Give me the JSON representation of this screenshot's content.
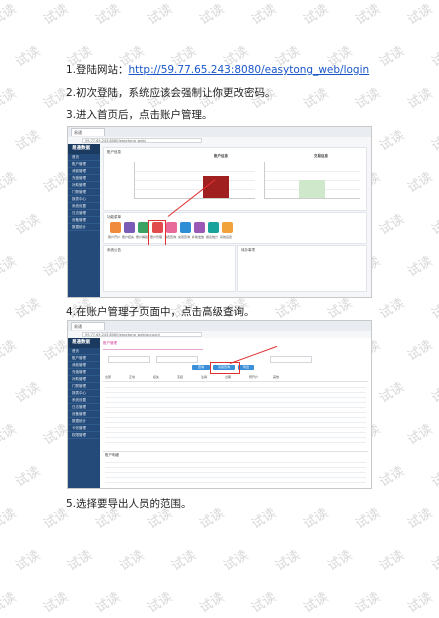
{
  "watermark": "试读",
  "steps": [
    {
      "prefix": "1.登陆网站：",
      "link": "http://59.77.65.243:8080/easytong_web/login"
    },
    {
      "text": "2.初次登陆，系统应该会强制让你更改密码。"
    },
    {
      "text": "3.进入首页后，点击账户管理。"
    },
    {
      "text": "4.在账户管理子页面中，点击高级查询。"
    },
    {
      "text": "5.选择要导出人员的范围。"
    }
  ],
  "screenshot1": {
    "tab_title": "易通",
    "url": "59.77.65.243:8080/easytong_web/",
    "logo": "易通数据",
    "sidebar_items": [
      "首页",
      "账户管理",
      "消费管理",
      "充值管理",
      "补助管理",
      "门禁管理",
      "报表中心",
      "系统设置",
      "日志管理",
      "设备管理",
      "数据统计"
    ],
    "chart_left_title": "账户信息",
    "chart_right_title": "交易信息",
    "apps_title": "功能菜单",
    "apps": [
      {
        "label": "账户开户",
        "color": "#f08a3c"
      },
      {
        "label": "账户挂失",
        "color": "#7a5bb5"
      },
      {
        "label": "账户解挂",
        "color": "#3aa363"
      },
      {
        "label": "账户管理",
        "color": "#e24b4b"
      },
      {
        "label": "消费查询",
        "color": "#e86a9a"
      },
      {
        "label": "充值查询",
        "color": "#2e8fd6"
      },
      {
        "label": "补助发放",
        "color": "#9b59b6"
      },
      {
        "label": "报表统计",
        "color": "#18a39b"
      },
      {
        "label": "系统设置",
        "color": "#f2a23a"
      }
    ],
    "panel_left_title": "系统公告",
    "panel_right_title": "待办事项"
  },
  "screenshot2": {
    "tab_title": "易通",
    "url": "59.77.65.243:8080/easytong_web/account",
    "logo": "易通数据",
    "sidebar_items": [
      "首页",
      "账户管理",
      "消费管理",
      "充值管理",
      "补助管理",
      "门禁管理",
      "报表中心",
      "系统设置",
      "日志管理",
      "设备管理",
      "数据统计",
      "卡务管理",
      "权限管理"
    ],
    "header_note": "账户管理",
    "buttons": [
      "查询",
      "高级查询",
      "导出"
    ],
    "tabs": [
      "全部",
      "正常",
      "挂失",
      "冻结",
      "注销",
      "过期",
      "预开户",
      "其他"
    ],
    "footer_label": "账户明细"
  }
}
